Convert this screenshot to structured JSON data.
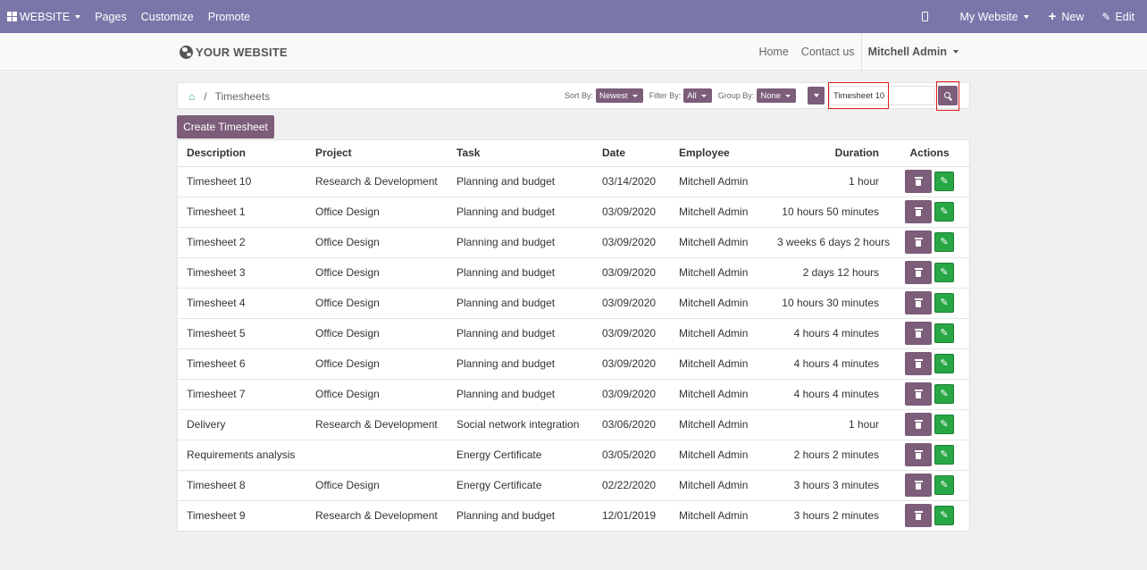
{
  "topbar": {
    "website_label": "WEBSITE",
    "pages": "Pages",
    "customize": "Customize",
    "promote": "Promote",
    "my_website": "My Website",
    "new": "New",
    "edit": "Edit"
  },
  "site": {
    "logo_text": "YOUR WEBSITE",
    "nav_home": "Home",
    "nav_contact": "Contact us",
    "user": "Mitchell Admin"
  },
  "breadcrumb": {
    "current": "Timesheets",
    "separator": "/"
  },
  "filters": {
    "sort_label": "Sort By:",
    "sort_value": "Newest",
    "filter_label": "Filter By:",
    "filter_value": "All",
    "group_label": "Group By:",
    "group_value": "None"
  },
  "search": {
    "value": "Timesheet 10"
  },
  "create_button": "Create Timesheet",
  "table": {
    "headers": [
      "Description",
      "Project",
      "Task",
      "Date",
      "Employee",
      "Duration",
      "Actions"
    ],
    "rows": [
      [
        "Timesheet 10",
        "Research & Development",
        "Planning and budget",
        "03/14/2020",
        "Mitchell Admin",
        "1 hour"
      ],
      [
        "Timesheet 1",
        "Office Design",
        "Planning and budget",
        "03/09/2020",
        "Mitchell Admin",
        "10 hours 50 minutes"
      ],
      [
        "Timesheet 2",
        "Office Design",
        "Planning and budget",
        "03/09/2020",
        "Mitchell Admin",
        "3 weeks 6 days 2 hours"
      ],
      [
        "Timesheet 3",
        "Office Design",
        "Planning and budget",
        "03/09/2020",
        "Mitchell Admin",
        "2 days 12 hours"
      ],
      [
        "Timesheet 4",
        "Office Design",
        "Planning and budget",
        "03/09/2020",
        "Mitchell Admin",
        "10 hours 30 minutes"
      ],
      [
        "Timesheet 5",
        "Office Design",
        "Planning and budget",
        "03/09/2020",
        "Mitchell Admin",
        "4 hours 4 minutes"
      ],
      [
        "Timesheet 6",
        "Office Design",
        "Planning and budget",
        "03/09/2020",
        "Mitchell Admin",
        "4 hours 4 minutes"
      ],
      [
        "Timesheet 7",
        "Office Design",
        "Planning and budget",
        "03/09/2020",
        "Mitchell Admin",
        "4 hours 4 minutes"
      ],
      [
        "Delivery",
        "Research & Development",
        "Social network integration",
        "03/06/2020",
        "Mitchell Admin",
        "1 hour"
      ],
      [
        "Requirements analysis",
        "",
        "Energy Certificate",
        "03/05/2020",
        "Mitchell Admin",
        "2 hours 2 minutes"
      ],
      [
        "Timesheet 8",
        "Office Design",
        "Energy Certificate",
        "02/22/2020",
        "Mitchell Admin",
        "3 hours 3 minutes"
      ],
      [
        "Timesheet 9",
        "Research & Development",
        "Planning and budget",
        "12/01/2019",
        "Mitchell Admin",
        "3 hours 2 minutes"
      ]
    ]
  }
}
